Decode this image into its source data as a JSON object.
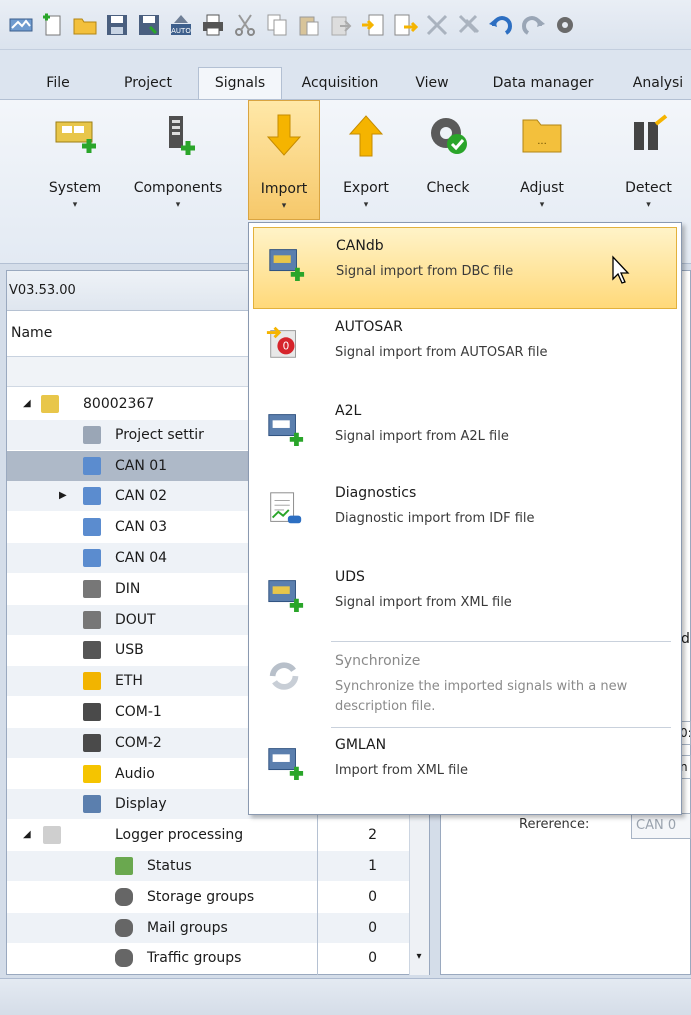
{
  "tabs": [
    "File",
    "Project",
    "Signals",
    "Acquisition",
    "View",
    "Data manager",
    "Analysi"
  ],
  "ribbon": {
    "buttons": [
      {
        "label": "System",
        "has_arrow": true
      },
      {
        "label": "Components",
        "has_arrow": true
      },
      {
        "label": "Import",
        "has_arrow": true
      },
      {
        "label": "Export",
        "has_arrow": true
      },
      {
        "label": "Check",
        "has_arrow": false
      },
      {
        "label": "Adjust",
        "has_arrow": true
      },
      {
        "label": "Detect",
        "has_arrow": true
      }
    ],
    "arrow_glyph": "▾"
  },
  "left_panel": {
    "version": "V03.53.00",
    "column_name": "Name",
    "tree": [
      {
        "label": "80002367",
        "value": "",
        "expander": "◢",
        "icon": "device-icon"
      },
      {
        "label": "Project settir",
        "value": "",
        "icon": "settings-icon"
      },
      {
        "label": "CAN 01",
        "value": "",
        "icon": "can-icon"
      },
      {
        "label": "CAN 02",
        "value": "",
        "expander": "▶",
        "icon": "can-icon"
      },
      {
        "label": "CAN 03",
        "value": "",
        "icon": "can-icon"
      },
      {
        "label": "CAN 04",
        "value": "",
        "icon": "can-icon"
      },
      {
        "label": "DIN",
        "value": "",
        "icon": "din-icon"
      },
      {
        "label": "DOUT",
        "value": "",
        "icon": "dout-icon"
      },
      {
        "label": "USB",
        "value": "",
        "icon": "usb-icon"
      },
      {
        "label": "ETH",
        "value": "",
        "icon": "eth-icon"
      },
      {
        "label": "COM-1",
        "value": "",
        "icon": "serial-icon"
      },
      {
        "label": "COM-2",
        "value": "",
        "icon": "serial-icon"
      },
      {
        "label": "Audio",
        "value": "",
        "icon": "audio-icon"
      },
      {
        "label": "Display",
        "value": "",
        "icon": "display-icon"
      },
      {
        "label": "Logger processing",
        "value": "2",
        "expander": "◢",
        "icon": "function-icon"
      },
      {
        "label": "Status",
        "value": "1",
        "icon": "status-icon"
      },
      {
        "label": "Storage groups",
        "value": "0",
        "icon": "database-icon"
      },
      {
        "label": "Mail groups",
        "value": "0",
        "icon": "database-icon"
      },
      {
        "label": "Traffic groups",
        "value": "0",
        "icon": "database-icon"
      }
    ]
  },
  "right_panel": {
    "reference_label": "Rererence:",
    "reference_value": "CAN 0",
    "partial_chars": [
      "d",
      "0:",
      "n"
    ]
  },
  "import_menu": {
    "items": [
      {
        "title": "CANdb",
        "desc": "Signal import from DBC file",
        "hot": true,
        "disabled": false,
        "icon": "dbc-import-icon"
      },
      {
        "title": "AUTOSAR",
        "desc": "Signal import from AUTOSAR file",
        "hot": false,
        "disabled": false,
        "icon": "autosar-icon"
      },
      {
        "title": "A2L",
        "desc": "Signal import from A2L file",
        "hot": false,
        "disabled": false,
        "icon": "a2l-import-icon"
      },
      {
        "title": "Diagnostics",
        "desc": "Diagnostic import from IDF file",
        "hot": false,
        "disabled": false,
        "icon": "diagnostics-icon"
      },
      {
        "title": "UDS",
        "desc": "Signal import from XML file",
        "hot": false,
        "disabled": false,
        "icon": "uds-import-icon"
      },
      {
        "title": "Synchronize",
        "desc": "Synchronize the imported signals with a new description file.",
        "hot": false,
        "disabled": true,
        "icon": "synchronize-icon"
      },
      {
        "title": "GMLAN",
        "desc": "Import from XML file",
        "hot": false,
        "disabled": false,
        "icon": "gmlan-import-icon"
      }
    ]
  },
  "colors": {
    "accent_hot": "#ffd97a",
    "selection": "#aeb9c8",
    "import_arrow": "#f5b400"
  }
}
